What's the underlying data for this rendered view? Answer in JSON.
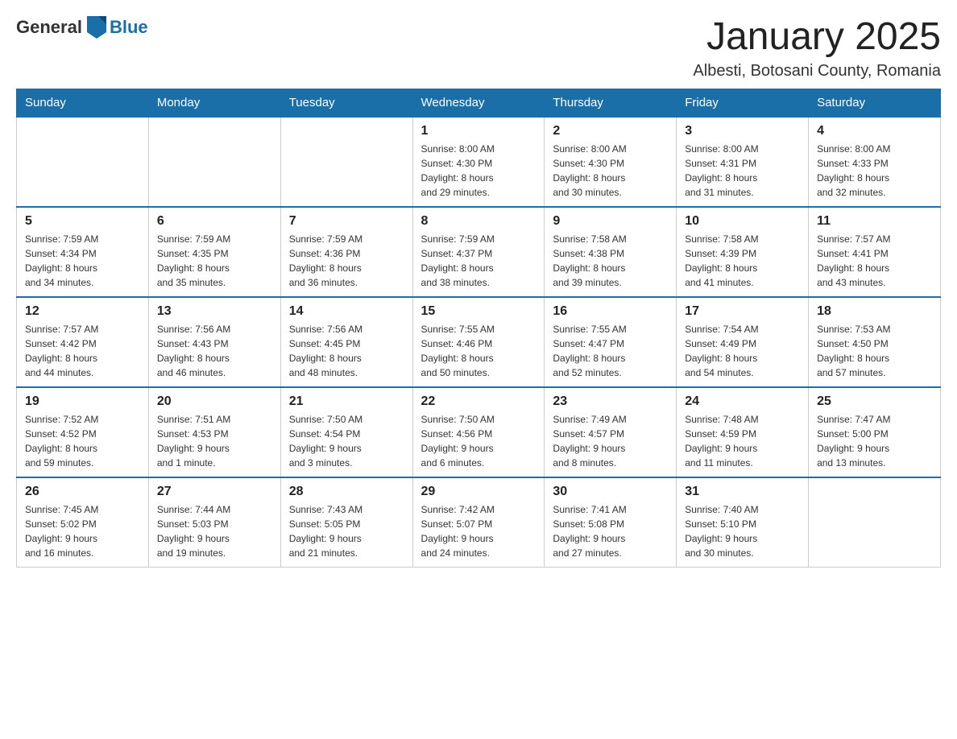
{
  "logo": {
    "general": "General",
    "blue": "Blue"
  },
  "title": "January 2025",
  "subtitle": "Albesti, Botosani County, Romania",
  "days_header": [
    "Sunday",
    "Monday",
    "Tuesday",
    "Wednesday",
    "Thursday",
    "Friday",
    "Saturday"
  ],
  "weeks": [
    {
      "days": [
        {
          "number": "",
          "info": ""
        },
        {
          "number": "",
          "info": ""
        },
        {
          "number": "",
          "info": ""
        },
        {
          "number": "1",
          "info": "Sunrise: 8:00 AM\nSunset: 4:30 PM\nDaylight: 8 hours\nand 29 minutes."
        },
        {
          "number": "2",
          "info": "Sunrise: 8:00 AM\nSunset: 4:30 PM\nDaylight: 8 hours\nand 30 minutes."
        },
        {
          "number": "3",
          "info": "Sunrise: 8:00 AM\nSunset: 4:31 PM\nDaylight: 8 hours\nand 31 minutes."
        },
        {
          "number": "4",
          "info": "Sunrise: 8:00 AM\nSunset: 4:33 PM\nDaylight: 8 hours\nand 32 minutes."
        }
      ]
    },
    {
      "days": [
        {
          "number": "5",
          "info": "Sunrise: 7:59 AM\nSunset: 4:34 PM\nDaylight: 8 hours\nand 34 minutes."
        },
        {
          "number": "6",
          "info": "Sunrise: 7:59 AM\nSunset: 4:35 PM\nDaylight: 8 hours\nand 35 minutes."
        },
        {
          "number": "7",
          "info": "Sunrise: 7:59 AM\nSunset: 4:36 PM\nDaylight: 8 hours\nand 36 minutes."
        },
        {
          "number": "8",
          "info": "Sunrise: 7:59 AM\nSunset: 4:37 PM\nDaylight: 8 hours\nand 38 minutes."
        },
        {
          "number": "9",
          "info": "Sunrise: 7:58 AM\nSunset: 4:38 PM\nDaylight: 8 hours\nand 39 minutes."
        },
        {
          "number": "10",
          "info": "Sunrise: 7:58 AM\nSunset: 4:39 PM\nDaylight: 8 hours\nand 41 minutes."
        },
        {
          "number": "11",
          "info": "Sunrise: 7:57 AM\nSunset: 4:41 PM\nDaylight: 8 hours\nand 43 minutes."
        }
      ]
    },
    {
      "days": [
        {
          "number": "12",
          "info": "Sunrise: 7:57 AM\nSunset: 4:42 PM\nDaylight: 8 hours\nand 44 minutes."
        },
        {
          "number": "13",
          "info": "Sunrise: 7:56 AM\nSunset: 4:43 PM\nDaylight: 8 hours\nand 46 minutes."
        },
        {
          "number": "14",
          "info": "Sunrise: 7:56 AM\nSunset: 4:45 PM\nDaylight: 8 hours\nand 48 minutes."
        },
        {
          "number": "15",
          "info": "Sunrise: 7:55 AM\nSunset: 4:46 PM\nDaylight: 8 hours\nand 50 minutes."
        },
        {
          "number": "16",
          "info": "Sunrise: 7:55 AM\nSunset: 4:47 PM\nDaylight: 8 hours\nand 52 minutes."
        },
        {
          "number": "17",
          "info": "Sunrise: 7:54 AM\nSunset: 4:49 PM\nDaylight: 8 hours\nand 54 minutes."
        },
        {
          "number": "18",
          "info": "Sunrise: 7:53 AM\nSunset: 4:50 PM\nDaylight: 8 hours\nand 57 minutes."
        }
      ]
    },
    {
      "days": [
        {
          "number": "19",
          "info": "Sunrise: 7:52 AM\nSunset: 4:52 PM\nDaylight: 8 hours\nand 59 minutes."
        },
        {
          "number": "20",
          "info": "Sunrise: 7:51 AM\nSunset: 4:53 PM\nDaylight: 9 hours\nand 1 minute."
        },
        {
          "number": "21",
          "info": "Sunrise: 7:50 AM\nSunset: 4:54 PM\nDaylight: 9 hours\nand 3 minutes."
        },
        {
          "number": "22",
          "info": "Sunrise: 7:50 AM\nSunset: 4:56 PM\nDaylight: 9 hours\nand 6 minutes."
        },
        {
          "number": "23",
          "info": "Sunrise: 7:49 AM\nSunset: 4:57 PM\nDaylight: 9 hours\nand 8 minutes."
        },
        {
          "number": "24",
          "info": "Sunrise: 7:48 AM\nSunset: 4:59 PM\nDaylight: 9 hours\nand 11 minutes."
        },
        {
          "number": "25",
          "info": "Sunrise: 7:47 AM\nSunset: 5:00 PM\nDaylight: 9 hours\nand 13 minutes."
        }
      ]
    },
    {
      "days": [
        {
          "number": "26",
          "info": "Sunrise: 7:45 AM\nSunset: 5:02 PM\nDaylight: 9 hours\nand 16 minutes."
        },
        {
          "number": "27",
          "info": "Sunrise: 7:44 AM\nSunset: 5:03 PM\nDaylight: 9 hours\nand 19 minutes."
        },
        {
          "number": "28",
          "info": "Sunrise: 7:43 AM\nSunset: 5:05 PM\nDaylight: 9 hours\nand 21 minutes."
        },
        {
          "number": "29",
          "info": "Sunrise: 7:42 AM\nSunset: 5:07 PM\nDaylight: 9 hours\nand 24 minutes."
        },
        {
          "number": "30",
          "info": "Sunrise: 7:41 AM\nSunset: 5:08 PM\nDaylight: 9 hours\nand 27 minutes."
        },
        {
          "number": "31",
          "info": "Sunrise: 7:40 AM\nSunset: 5:10 PM\nDaylight: 9 hours\nand 30 minutes."
        },
        {
          "number": "",
          "info": ""
        }
      ]
    }
  ]
}
